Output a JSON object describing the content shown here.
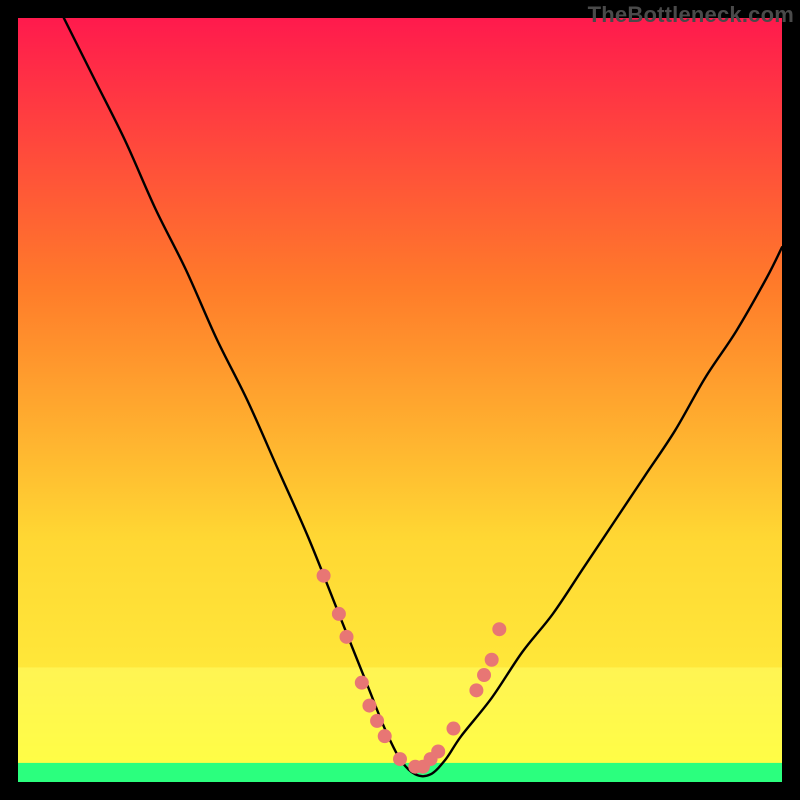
{
  "watermark": "TheBottleneck.com",
  "chart_data": {
    "type": "line",
    "title": "",
    "xlabel": "",
    "ylabel": "",
    "xlim": [
      0,
      100
    ],
    "ylim": [
      0,
      100
    ],
    "background_gradient": {
      "top": "#ff1a4d",
      "mid1": "#ff7b2a",
      "mid2": "#ffd733",
      "bottom_band": "#ffff66",
      "baseline": "#2bff7e"
    },
    "curve": {
      "name": "v-curve",
      "x": [
        6,
        10,
        14,
        18,
        22,
        26,
        30,
        34,
        38,
        42,
        44,
        46,
        48,
        50,
        52,
        54,
        56,
        58,
        62,
        66,
        70,
        74,
        78,
        82,
        86,
        90,
        94,
        98,
        100
      ],
      "y": [
        100,
        92,
        84,
        75,
        67,
        58,
        50,
        41,
        32,
        22,
        17,
        12,
        7,
        3,
        1,
        1,
        3,
        6,
        11,
        17,
        22,
        28,
        34,
        40,
        46,
        53,
        59,
        66,
        70
      ]
    },
    "markers": {
      "name": "highlight-points",
      "color": "#e87674",
      "x": [
        40,
        42,
        43,
        45,
        46,
        47,
        48,
        50,
        52,
        53,
        54,
        55,
        57,
        60,
        61,
        62,
        63
      ],
      "y": [
        27,
        22,
        19,
        13,
        10,
        8,
        6,
        3,
        2,
        2,
        3,
        4,
        7,
        12,
        14,
        16,
        20
      ]
    }
  }
}
